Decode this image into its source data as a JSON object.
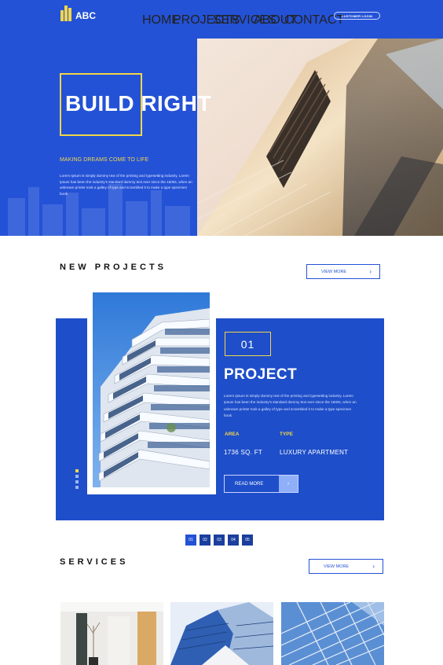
{
  "brand": {
    "name": "ABC"
  },
  "nav": {
    "items": [
      "HOME",
      "PROJECTS",
      "SERVICES",
      "ABOUT",
      "CONTACT"
    ],
    "login": "CUSTOMER LOGIN"
  },
  "hero": {
    "title": "BUILD RIGHT",
    "subtitle": "MAKING DREAMS COME TO LIFE",
    "text": "Lorem Ipsum is simply dummy text of the printing and typesetting industry. Lorem Ipsum has been the industry's standard dummy text ever since the 1500s, when an unknown printer took a galley of type and scrambled it to make a type specimen book."
  },
  "projects": {
    "section_title": "NEW PROJECTS",
    "view_more": "VIEW MORE",
    "number": "01",
    "title": "PROJECT",
    "text": "Lorem Ipsum is simply dummy text of the printing and typesetting industry. Lorem Ipsum has been the industry's standard dummy text ever since the 1500s, when an unknown printer took a galley of type and scrambled it to make a type specimen book.",
    "area_label": "AREA",
    "area_value": "1736 SQ. FT",
    "type_label": "TYPE",
    "type_value": "LUXURY APARTMENT",
    "read_more": "READ MORE",
    "pager": [
      "01",
      "02",
      "03",
      "04",
      "05"
    ]
  },
  "services": {
    "section_title": "SERVICES",
    "view_more": "VIEW MORE"
  },
  "icons": {
    "chevron": "chevron-right-icon",
    "logo": "building-logo-icon"
  },
  "colors": {
    "primary": "#2452d6",
    "accent": "#f2d64b",
    "panel": "#1e4ec9"
  }
}
